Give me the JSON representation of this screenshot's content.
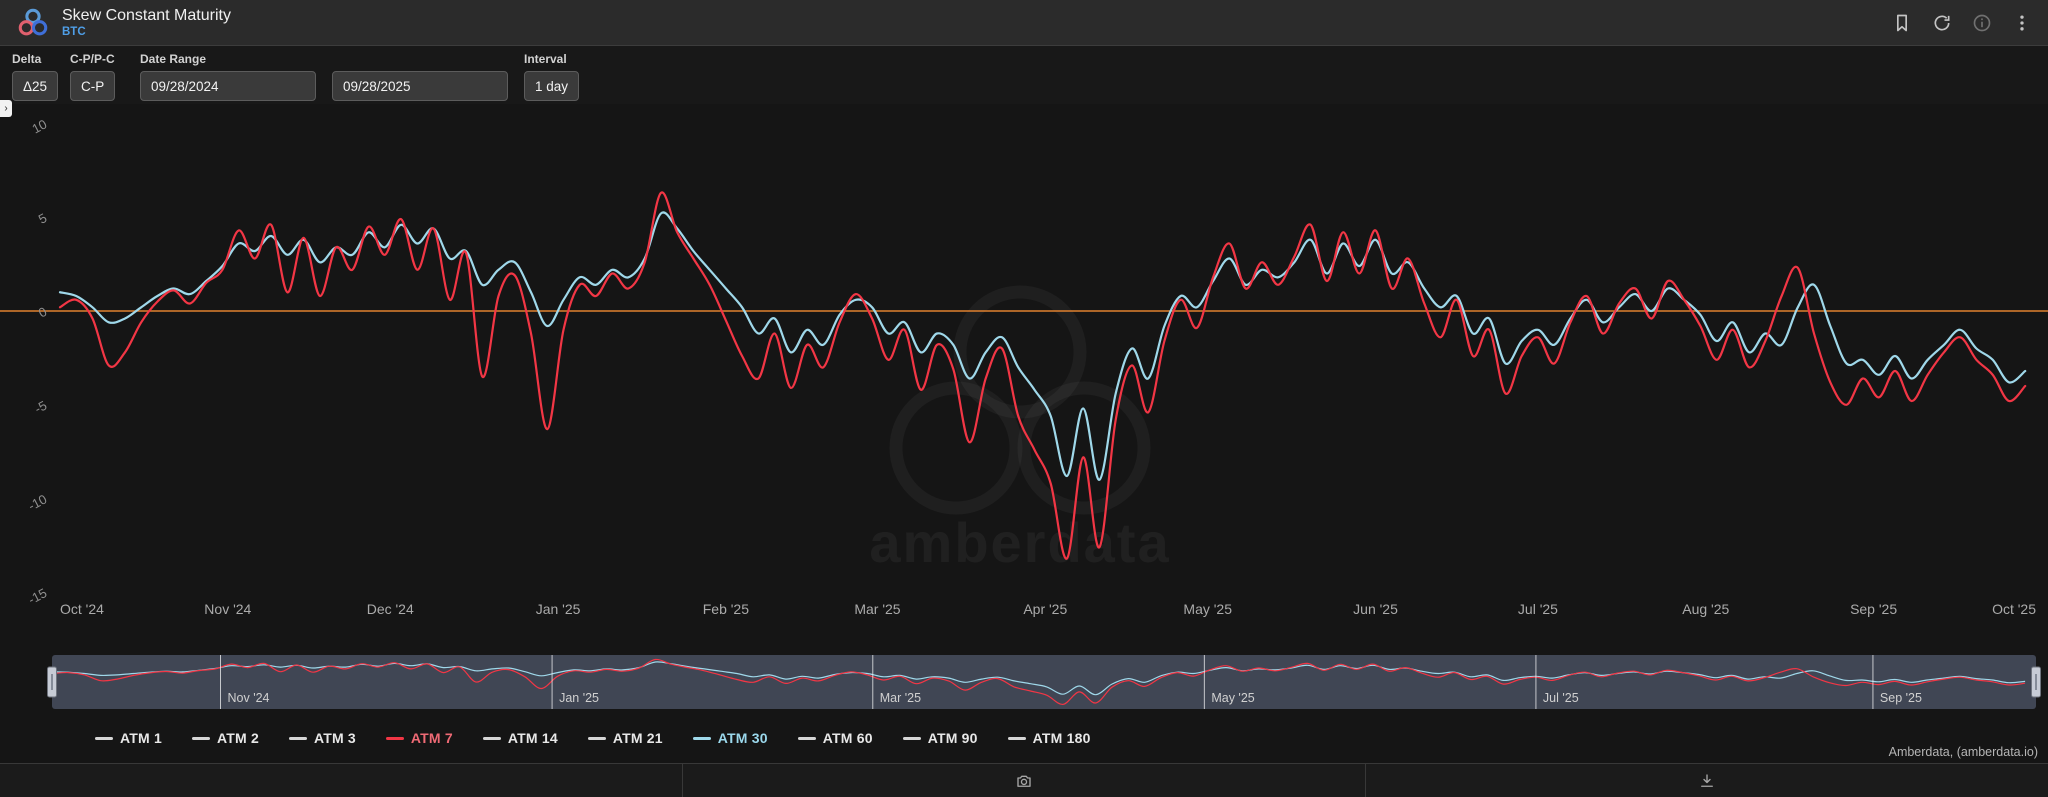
{
  "header": {
    "title": "Skew Constant Maturity",
    "subtitle": "BTC",
    "actions": [
      "bookmark-icon",
      "refresh-icon",
      "info-icon",
      "kebab-menu-icon"
    ]
  },
  "filters": {
    "delta": {
      "label": "Delta",
      "value": "Δ25"
    },
    "cppc": {
      "label": "C-P/P-C",
      "value": "C-P"
    },
    "date_range": {
      "label": "Date Range",
      "start": "09/28/2024",
      "end": "09/28/2025"
    },
    "interval": {
      "label": "Interval",
      "value": "1 day"
    }
  },
  "watermark": "amberdata",
  "attribution": "Amberdata, (amberdata.io)",
  "toolbar": {
    "buttons": [
      "blank",
      "camera-icon",
      "download-icon"
    ]
  },
  "legend": {
    "position": "bottom",
    "items": [
      {
        "label": "ATM 1",
        "marker_color": "#d6d6d6",
        "text_color": "#e8e8e8",
        "active": false
      },
      {
        "label": "ATM 2",
        "marker_color": "#d6d6d6",
        "text_color": "#e8e8e8",
        "active": false
      },
      {
        "label": "ATM 3",
        "marker_color": "#d6d6d6",
        "text_color": "#e8e8e8",
        "active": false
      },
      {
        "label": "ATM 7",
        "marker_color": "#f23645",
        "text_color": "#ef6a75",
        "active": true
      },
      {
        "label": "ATM 14",
        "marker_color": "#d6d6d6",
        "text_color": "#e8e8e8",
        "active": false
      },
      {
        "label": "ATM 21",
        "marker_color": "#d6d6d6",
        "text_color": "#e8e8e8",
        "active": false
      },
      {
        "label": "ATM 30",
        "marker_color": "#9fd8ea",
        "text_color": "#9bd8ec",
        "active": true
      },
      {
        "label": "ATM 60",
        "marker_color": "#d6d6d6",
        "text_color": "#e8e8e8",
        "active": false
      },
      {
        "label": "ATM 90",
        "marker_color": "#d6d6d6",
        "text_color": "#e8e8e8",
        "active": false
      },
      {
        "label": "ATM 180",
        "marker_color": "#d6d6d6",
        "text_color": "#e8e8e8",
        "active": false
      }
    ]
  },
  "chart_data": {
    "type": "line",
    "title": "Skew Constant Maturity (BTC)",
    "ylabel": "",
    "xlabel": "",
    "ylim": [
      -15,
      10
    ],
    "grid": false,
    "zero_line_color": "#e0812f",
    "sample_interval_days": 3,
    "domain_days": 365,
    "x_axis": {
      "ticks": [
        {
          "label": "Oct '24",
          "t": 0
        },
        {
          "label": "Nov '24",
          "t": 31
        },
        {
          "label": "Dec '24",
          "t": 61
        },
        {
          "label": "Jan '25",
          "t": 92
        },
        {
          "label": "Feb '25",
          "t": 123
        },
        {
          "label": "Mar '25",
          "t": 151
        },
        {
          "label": "Apr '25",
          "t": 182
        },
        {
          "label": "May '25",
          "t": 212
        },
        {
          "label": "Jun '25",
          "t": 243
        },
        {
          "label": "Jul '25",
          "t": 273
        },
        {
          "label": "Aug '25",
          "t": 304
        },
        {
          "label": "Sep '25",
          "t": 335
        },
        {
          "label": "Oct '25",
          "t": 365
        }
      ]
    },
    "y_axis": {
      "ticks": [
        10,
        5,
        0,
        -5,
        -10,
        -15
      ]
    },
    "series": [
      {
        "name": "ATM 7",
        "color": "#f23645",
        "values": [
          0.2,
          0.6,
          -0.4,
          -2.9,
          -2.2,
          -0.6,
          0.5,
          1.1,
          0.4,
          1.5,
          2.2,
          4.3,
          2.8,
          4.6,
          1.0,
          3.9,
          0.8,
          3.4,
          2.2,
          4.5,
          3.0,
          4.9,
          2.2,
          4.4,
          0.6,
          3.1,
          -3.5,
          0.8,
          1.9,
          -1.2,
          -6.3,
          -1.0,
          1.4,
          0.8,
          2.0,
          1.2,
          2.6,
          6.3,
          4.2,
          2.8,
          1.4,
          -0.5,
          -2.4,
          -3.6,
          -1.2,
          -4.1,
          -1.8,
          -3.0,
          -0.6,
          0.9,
          -0.4,
          -2.6,
          -1.0,
          -4.2,
          -1.8,
          -3.1,
          -7.0,
          -3.6,
          -2.0,
          -5.6,
          -7.4,
          -9.2,
          -13.2,
          -7.8,
          -12.6,
          -5.8,
          -2.9,
          -5.4,
          -1.6,
          0.6,
          -0.9,
          1.8,
          3.6,
          1.2,
          2.6,
          1.4,
          2.9,
          4.6,
          1.6,
          4.2,
          2.0,
          4.3,
          1.2,
          2.8,
          0.4,
          -1.4,
          0.6,
          -2.4,
          -1.0,
          -4.4,
          -2.4,
          -1.4,
          -2.8,
          -0.6,
          0.8,
          -1.2,
          0.4,
          1.2,
          -0.4,
          1.6,
          0.6,
          -0.8,
          -2.6,
          -1.0,
          -3.0,
          -1.6,
          0.8,
          2.3,
          -1.2,
          -3.8,
          -5.0,
          -3.6,
          -4.6,
          -3.2,
          -4.8,
          -3.4,
          -2.2,
          -1.4,
          -2.6,
          -3.4,
          -4.8,
          -4.0
        ]
      },
      {
        "name": "ATM 30",
        "color": "#9fd8ea",
        "values": [
          1.0,
          0.8,
          0.2,
          -0.6,
          -0.4,
          0.2,
          0.8,
          1.2,
          0.9,
          1.6,
          2.4,
          3.6,
          3.2,
          4.0,
          3.0,
          3.8,
          2.6,
          3.4,
          3.0,
          4.2,
          3.4,
          4.6,
          3.6,
          4.4,
          2.8,
          3.2,
          1.4,
          2.2,
          2.6,
          1.0,
          -0.8,
          0.6,
          1.8,
          1.4,
          2.2,
          1.8,
          2.8,
          5.2,
          4.4,
          3.2,
          2.2,
          1.2,
          0.2,
          -1.2,
          -0.4,
          -2.2,
          -1.0,
          -1.8,
          -0.2,
          0.6,
          0.2,
          -1.2,
          -0.6,
          -2.2,
          -1.2,
          -1.8,
          -3.6,
          -2.2,
          -1.4,
          -3.0,
          -4.2,
          -5.6,
          -8.8,
          -5.2,
          -9.0,
          -4.4,
          -2.0,
          -3.6,
          -0.8,
          0.8,
          0.2,
          1.6,
          2.8,
          1.4,
          2.2,
          1.8,
          2.6,
          3.8,
          2.0,
          3.6,
          2.4,
          3.8,
          2.0,
          2.6,
          1.2,
          0.2,
          0.8,
          -1.2,
          -0.4,
          -2.8,
          -1.6,
          -1.0,
          -1.8,
          -0.4,
          0.6,
          -0.6,
          0.2,
          0.9,
          0.0,
          1.2,
          0.6,
          -0.2,
          -1.6,
          -0.6,
          -2.2,
          -1.2,
          -1.8,
          0.2,
          1.4,
          -0.8,
          -2.8,
          -2.6,
          -3.4,
          -2.4,
          -3.6,
          -2.6,
          -1.8,
          -1.0,
          -2.0,
          -2.6,
          -3.8,
          -3.2
        ]
      }
    ],
    "navigator": {
      "background": "#404654",
      "labels": [
        {
          "text": "Nov '24",
          "t": 31
        },
        {
          "text": "Jan '25",
          "t": 92
        },
        {
          "text": "Mar '25",
          "t": 151
        },
        {
          "text": "May '25",
          "t": 212
        },
        {
          "text": "Jul '25",
          "t": 273
        },
        {
          "text": "Sep '25",
          "t": 335
        }
      ]
    }
  }
}
